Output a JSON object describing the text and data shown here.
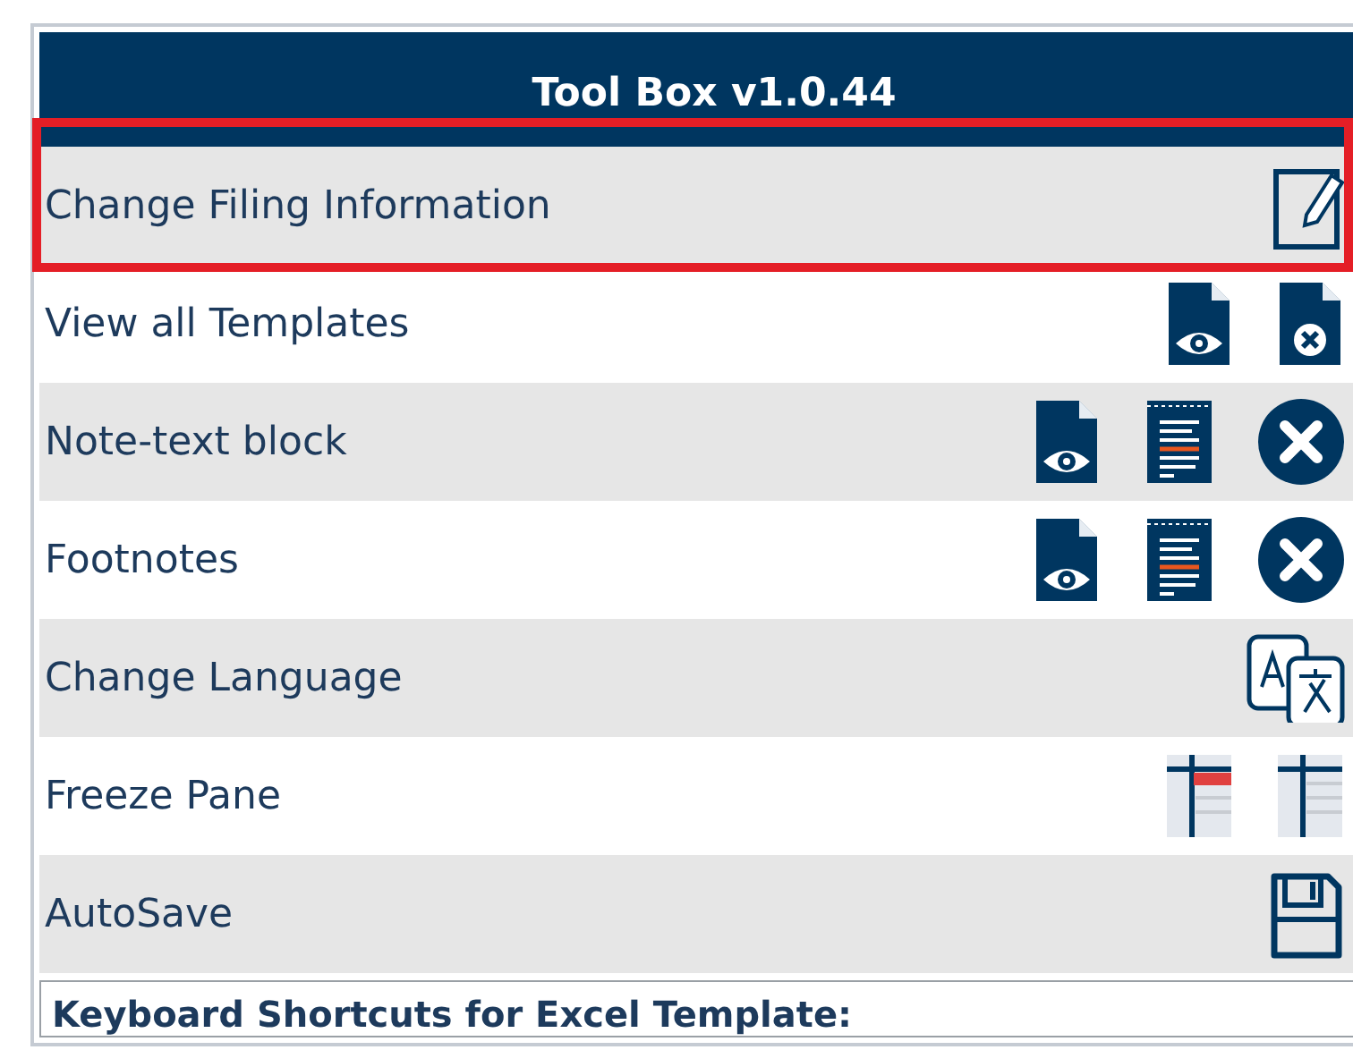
{
  "header": {
    "title": "Tool Box v1.0.44"
  },
  "rows": [
    {
      "label": "Change Filing Information",
      "highlighted": true,
      "icons": [
        {
          "kind": "edit"
        }
      ]
    },
    {
      "label": "View all Templates",
      "highlighted": false,
      "icons": [
        {
          "kind": "doc-view"
        },
        {
          "kind": "doc-remove"
        }
      ]
    },
    {
      "label": "Note-text block",
      "highlighted": false,
      "icons": [
        {
          "kind": "doc-view"
        },
        {
          "kind": "note"
        },
        {
          "kind": "remove"
        }
      ]
    },
    {
      "label": "Footnotes",
      "highlighted": false,
      "icons": [
        {
          "kind": "doc-view"
        },
        {
          "kind": "note"
        },
        {
          "kind": "remove"
        }
      ]
    },
    {
      "label": "Change Language",
      "highlighted": false,
      "icons": [
        {
          "kind": "translate"
        }
      ]
    },
    {
      "label": "Freeze Pane",
      "highlighted": false,
      "icons": [
        {
          "kind": "freeze-on"
        },
        {
          "kind": "freeze-off"
        }
      ]
    },
    {
      "label": "AutoSave",
      "highlighted": false,
      "icons": [
        {
          "kind": "save"
        }
      ]
    }
  ],
  "shortcuts": {
    "title": "Keyboard Shortcuts for Excel Template:"
  }
}
